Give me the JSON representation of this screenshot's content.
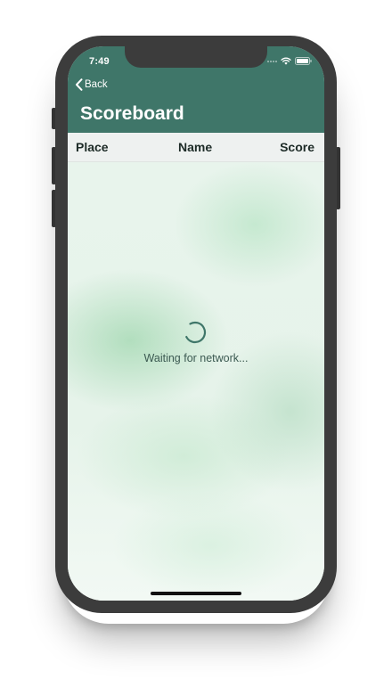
{
  "status_bar": {
    "time": "7:49",
    "icons": [
      "signal-dots-icon",
      "wifi-icon",
      "battery-icon"
    ]
  },
  "nav": {
    "back_label": "Back",
    "title": "Scoreboard"
  },
  "table": {
    "columns": [
      "Place",
      "Name",
      "Score"
    ],
    "rows": []
  },
  "loading": {
    "text": "Waiting for network..."
  },
  "colors": {
    "nav_background": "#3f7669",
    "header_row_background": "#eef1f0",
    "accent_green": "#3f7669",
    "phone_frame": "#3c3c3c"
  }
}
